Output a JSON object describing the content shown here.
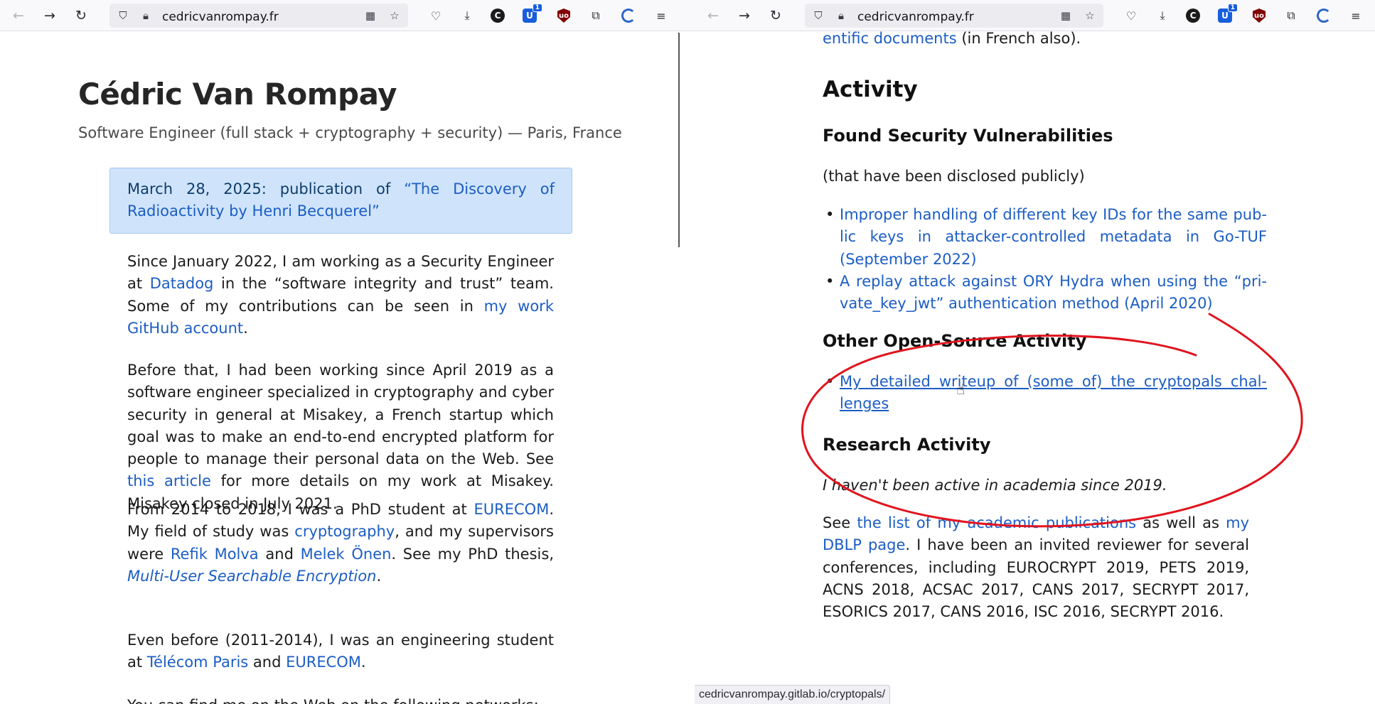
{
  "left": {
    "url": "cedricvanrompay.fr",
    "title": "Cédric Van Rompay",
    "subtitle": "Software Engineer (full stack + cryptography + security) — Paris, France",
    "notice": {
      "prefix": "March 28, 2025: publication of ",
      "link": "“The Discovery of Radioactivity by Henri Becquerel”"
    },
    "p1": {
      "t1": "Since January 2022, I am working as a Security Engineer at ",
      "l1": "Datadog",
      "t2": " in the “software integrity and trust” team. Some of my contributions can be seen in ",
      "l2": "my work GitHub account",
      "t3": "."
    },
    "p2": {
      "t1": "Before that, I had been working since April 2019 as a software engineer specialized in cryptography and cyber security in general at Misakey, a French startup which goal was to make an end-to-end encrypted platform for people to manage their personal data on the Web. See ",
      "l1": "this article",
      "t2": " for more details on my work at Misakey. Misakey closed in July 2021."
    },
    "p3": {
      "t1": "From 2014 to 2018, I was a PhD student at ",
      "l1": "EURECOM",
      "t2": ". My field of study was ",
      "l2": "cryptography",
      "t3": ", and my supervisors were ",
      "l3": "Refik Molva",
      "t4": " and ",
      "l4": "Melek Önen",
      "t5": ". See my PhD thesis, ",
      "l5": "Multi-User Searchable Encryption",
      "t6": "."
    },
    "p4": {
      "t1": "Even before (2011-2014), I was an engineering student at ",
      "l1": "Télécom Paris",
      "t2": " and ",
      "l2": "EURECOM",
      "t3": "."
    },
    "p5_partial": "You can find me on the Web on the following networks:"
  },
  "right": {
    "url": "cedricvanrompay.fr",
    "top_link": "entific documents",
    "top_text": " (in French also).",
    "activity_heading": "Activity",
    "vuln_heading": "Found Security Vulnerabilities",
    "vuln_note": "(that have been disclosed publicly)",
    "vulns": [
      "Improper handling of different key IDs for the same pub-lic keys in attacker-controlled metadata in Go-TUF (September 2022)",
      "A replay attack against ORY Hydra when using the “pri-vate_key_jwt” authentication method (April 2020)"
    ],
    "oss_heading": "Other Open-Source Activity",
    "oss_items": [
      "My detailed writeup of (some of) the cryptopals chal-lenges"
    ],
    "research_heading": "Research Activity",
    "research_note": "I haven't been active in academia since 2019.",
    "research_p": {
      "t1": "See ",
      "l1": "the list of my academic publications",
      "t2": " as well as ",
      "l2": "my DBLP page",
      "t3": ". I have been an invited reviewer for several conferences, including EUROCRYPT 2019, PETS 2019, ACNS 2018, ACSAC 2017, CANS 2017, SECRYPT 2017, ESORICS 2017, CANS 2016, ISC 2016, SECRYPT 2016."
    },
    "status_url": "cedricvanrompay.gitlab.io/cryptopals/",
    "ext_badge": "1",
    "annotation_color": "#e0141e"
  }
}
